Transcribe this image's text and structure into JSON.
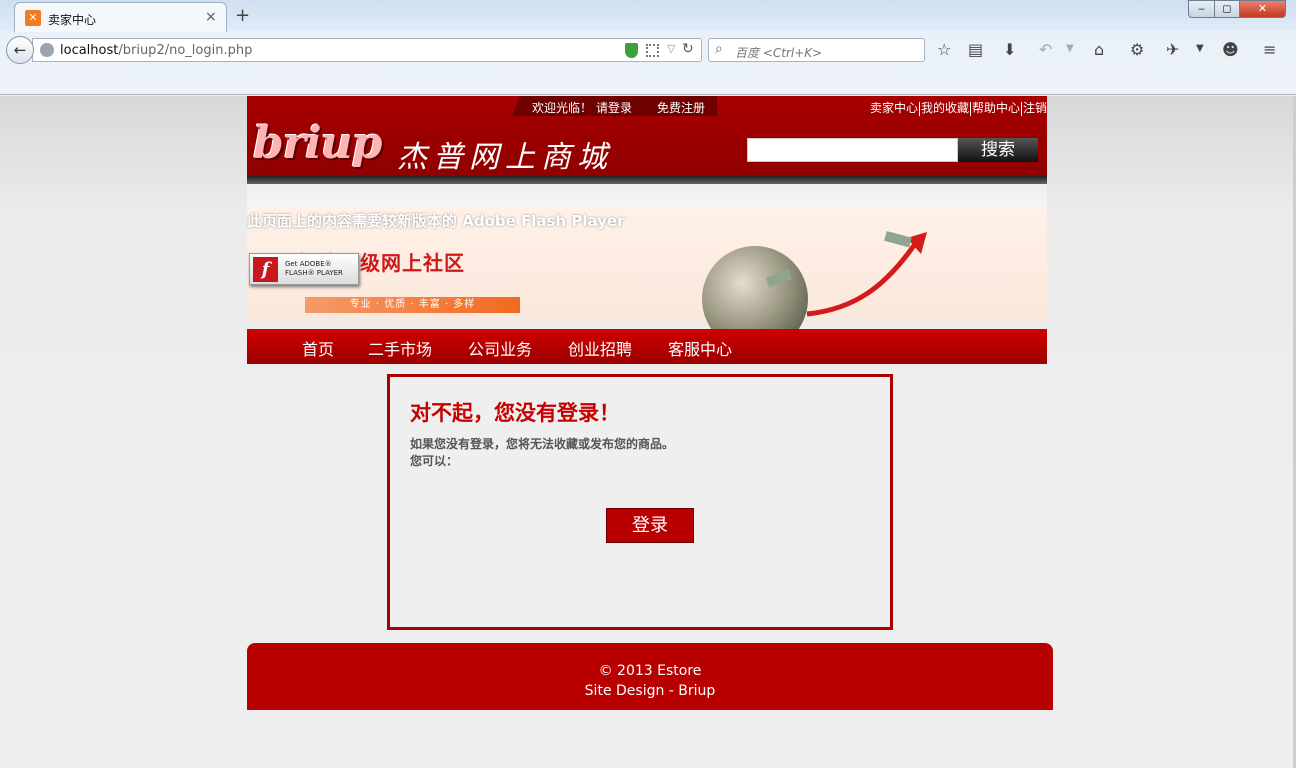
{
  "browser": {
    "tab_title": "卖家中心",
    "tab_close": "×",
    "new_tab": "+",
    "url_host": "localhost",
    "url_path": "/briup2/no_login.php",
    "search_placeholder": "百度 <Ctrl+K>",
    "window_min": "‒",
    "window_max": "◻",
    "window_close": "✕"
  },
  "header": {
    "welcome": "欢迎光临！",
    "login_link": "请登录",
    "register_link": "免费注册",
    "top_links": [
      "卖家中心",
      "我的收藏",
      "帮助中心",
      "注销"
    ],
    "logo_text": "briup",
    "logo_cn": "杰普网上商城",
    "search_button": "搜索"
  },
  "banner": {
    "flash_notice": "此页面上的内容需要较新版本的 Adobe Flash Player",
    "title": "打造顶级网上社区",
    "get_flash_line1": "Get ADOBE®",
    "get_flash_line2": "FLASH® PLAYER",
    "tagline": "专业 · 优质 · 丰富 · 多样"
  },
  "menu": {
    "items": [
      "首页",
      "二手市场",
      "公司业务",
      "创业招聘",
      "客服中心"
    ]
  },
  "notice": {
    "title": "对不起，您没有登录！",
    "line1": "如果您没有登录，您将无法收藏或发布您的商品。",
    "line2": "您可以：",
    "login_button": "登录"
  },
  "footer": {
    "line1": "© 2013 Estore",
    "line2": "Site Design - Briup"
  },
  "colors": {
    "brand_red": "#b80000",
    "dark_red": "#8c0000"
  }
}
